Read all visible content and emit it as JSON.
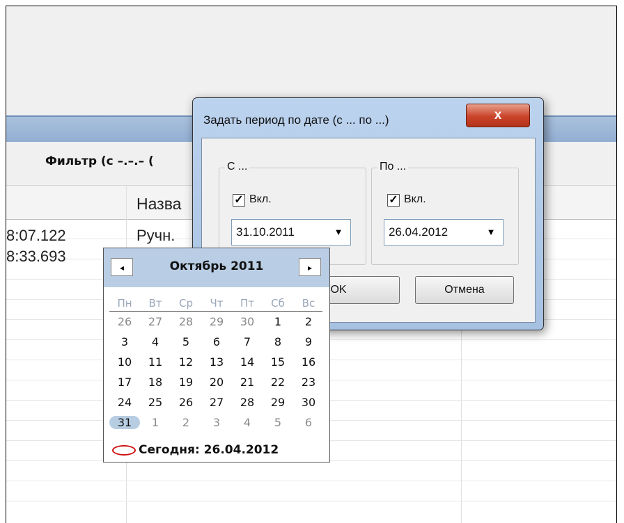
{
  "grid": {
    "filter_label": "Фильтр (с –.–.– (",
    "column_name_header": "Назва",
    "rows": [
      {
        "time": "8:07.122",
        "name": "Ручн."
      },
      {
        "time": "8:33.693",
        "name": ""
      }
    ]
  },
  "dialog": {
    "title": "Задать период по дате (с ... по ...)",
    "close_label": "x",
    "from_group": {
      "legend": "С ...",
      "enabled_label": "Вкл.",
      "checked": true,
      "date": "31.10.2011"
    },
    "to_group": {
      "legend": "По ...",
      "enabled_label": "Вкл.",
      "checked": true,
      "date": "26.04.2012"
    },
    "ok_label": "OK",
    "cancel_label": "Отмена"
  },
  "calendar": {
    "month_label": "Октябрь 2011",
    "prev_label": "◂",
    "next_label": "▸",
    "weekdays": [
      "Пн",
      "Вт",
      "Ср",
      "Чт",
      "Пт",
      "Сб",
      "Вс"
    ],
    "weeks": [
      [
        "26",
        "27",
        "28",
        "29",
        "30",
        "1",
        "2"
      ],
      [
        "3",
        "4",
        "5",
        "6",
        "7",
        "8",
        "9"
      ],
      [
        "10",
        "11",
        "12",
        "13",
        "14",
        "15",
        "16"
      ],
      [
        "17",
        "18",
        "19",
        "20",
        "21",
        "22",
        "23"
      ],
      [
        "24",
        "25",
        "26",
        "27",
        "28",
        "29",
        "30"
      ],
      [
        "31",
        "1",
        "2",
        "3",
        "4",
        "5",
        "6"
      ]
    ],
    "selected_day": "31",
    "today_label": "Сегодня: 26.04.2012"
  }
}
